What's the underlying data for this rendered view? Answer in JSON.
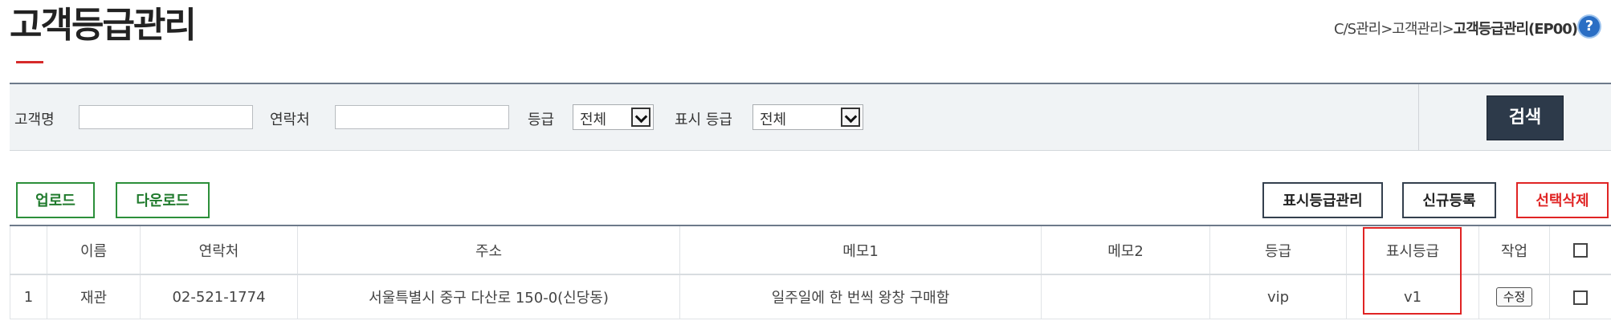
{
  "page": {
    "title": "고객등급관리",
    "breadcrumb": [
      "C/S관리",
      ">",
      "고객관리",
      ">",
      "고객등급관리(EP00)"
    ],
    "help_icon": "?"
  },
  "search": {
    "customer_name_label": "고객명",
    "customer_name_value": "",
    "contact_label": "연락처",
    "contact_value": "",
    "grade_label": "등급",
    "grade_selected": "전체",
    "display_grade_label": "표시 등급",
    "display_grade_selected": "전체",
    "search_button": "검색"
  },
  "actions": {
    "upload": "업로드",
    "download": "다운로드",
    "display_grade_manage": "표시등급관리",
    "new_register": "신규등록",
    "delete_selected": "선택삭제"
  },
  "table": {
    "columns": [
      "",
      "이름",
      "연락처",
      "주소",
      "메모1",
      "메모2",
      "등급",
      "표시등급",
      "작업",
      ""
    ],
    "rows": [
      {
        "no": "1",
        "name": "재관",
        "contact": "02-521-1774",
        "address": "서울특별시 중구 다산로 150-0(신당동)",
        "memo1": "일주일에 한 번씩 왕창 구매함",
        "memo2": "",
        "grade": "vip",
        "display_grade": "v1",
        "action": "수정"
      }
    ]
  },
  "colors": {
    "accent_red": "#e02424",
    "search_button_bg": "#2d3a4a",
    "green_button": "#2c8f3a",
    "help_icon_blue": "#2a6ec4"
  }
}
